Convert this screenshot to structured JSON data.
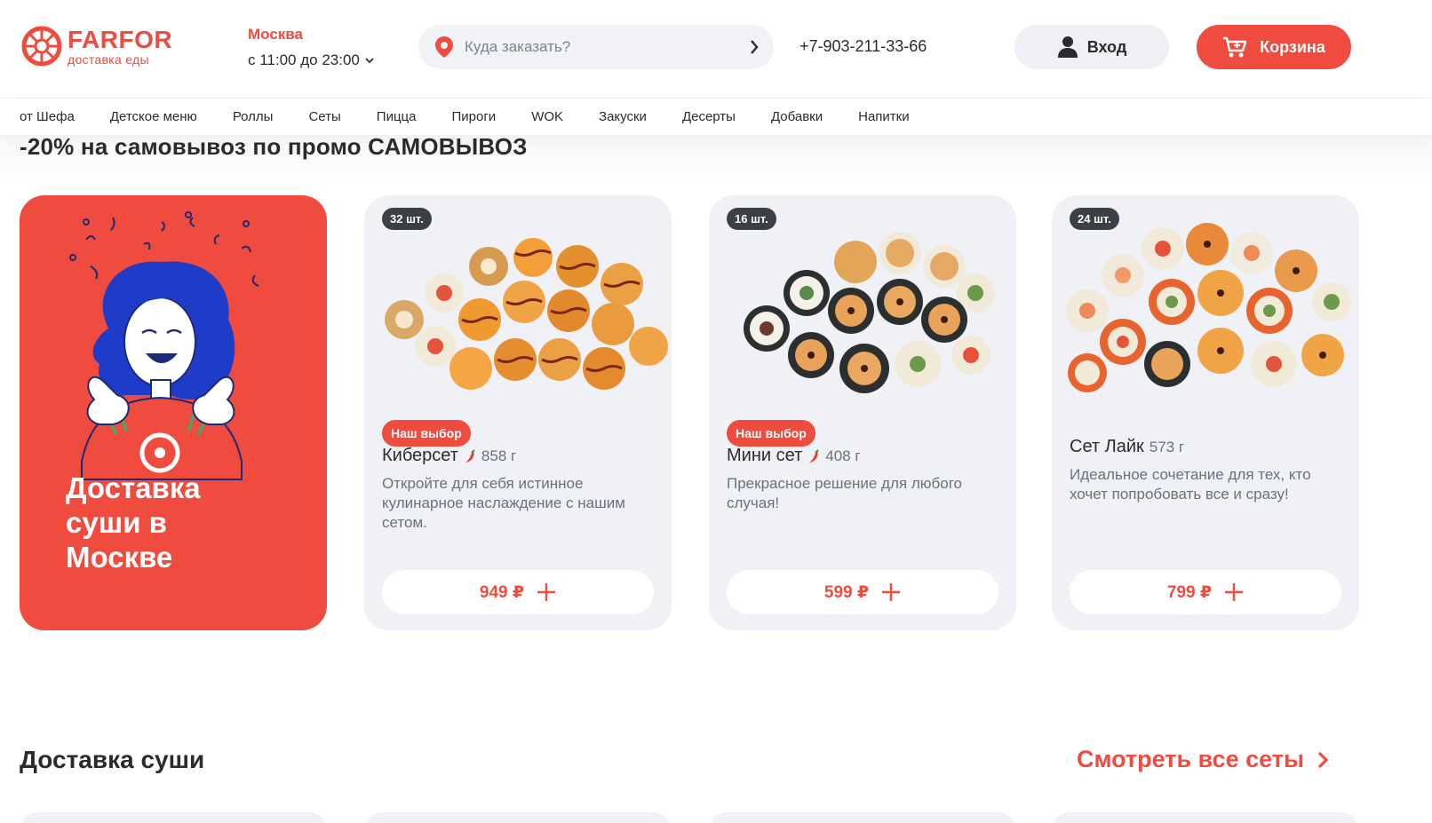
{
  "brand": {
    "name": "FARFOR",
    "tagline": "доставка еды",
    "accent": "#ef4b3f"
  },
  "location": {
    "city": "Москва",
    "hours": "с 11:00 до 23:00"
  },
  "search": {
    "placeholder": "Куда заказать?"
  },
  "phone": "+7-903-211-33-66",
  "header": {
    "login_label": "Вход",
    "cart_label": "Корзина"
  },
  "nav": [
    "от Шефа",
    "Детское меню",
    "Роллы",
    "Сеты",
    "Пицца",
    "Пироги",
    "WOK",
    "Закуски",
    "Десерты",
    "Добавки",
    "Напитки"
  ],
  "promo_text": "-20% на самовывоз по промо САМОВЫВОЗ",
  "hero": {
    "title": "Доставка суши в Москве"
  },
  "products": [
    {
      "count": "32 шт.",
      "badge": "Наш выбор",
      "name": "Киберсет",
      "spicy": true,
      "weight": "858 г",
      "description": "Откройте для себя истинное кулинарное наслаждение с нашим сетом.",
      "price": "949 ₽"
    },
    {
      "count": "16 шт.",
      "badge": "Наш выбор",
      "name": "Мини сет",
      "spicy": true,
      "weight": "408 г",
      "description": "Прекрасное решение для любого случая!",
      "price": "599 ₽"
    },
    {
      "count": "24 шт.",
      "badge": "",
      "name": "Сет Лайк",
      "spicy": false,
      "weight": "573 г",
      "description": "Идеальное сочетание для тех, кто хочет попробовать все и сразу!",
      "price": "799 ₽"
    }
  ],
  "section": {
    "title": "Доставка суши",
    "see_all": "Смотреть все сеты"
  }
}
